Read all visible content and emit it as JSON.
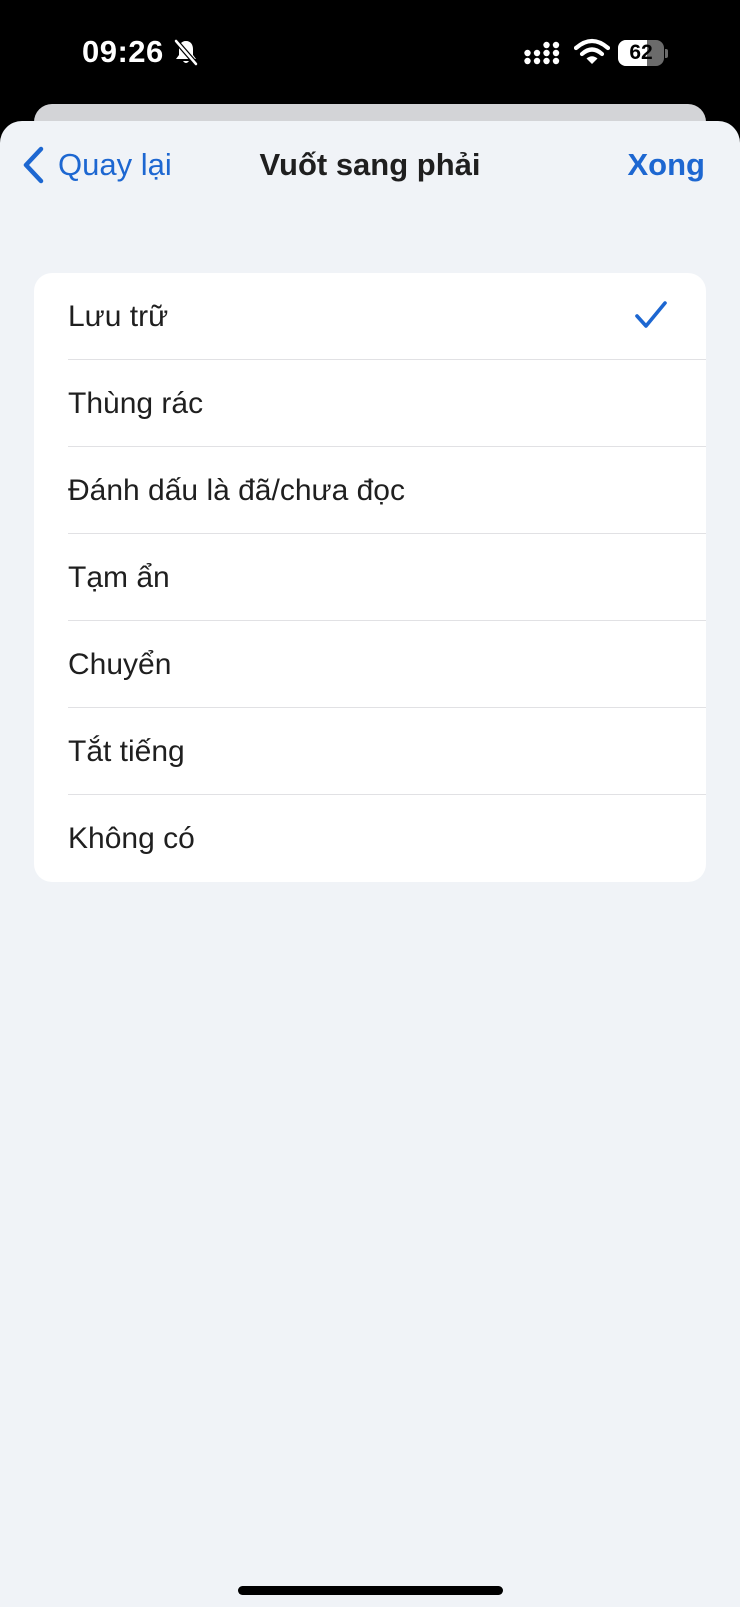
{
  "status_bar": {
    "time": "09:26",
    "battery_level": "62",
    "battery_fraction": 0.62
  },
  "nav": {
    "back_label": "Quay lại",
    "title": "Vuốt sang phải",
    "done_label": "Xong"
  },
  "options": [
    {
      "label": "Lưu trữ",
      "selected": true
    },
    {
      "label": "Thùng rác",
      "selected": false
    },
    {
      "label": "Đánh dấu là đã/chưa đọc",
      "selected": false
    },
    {
      "label": "Tạm ẩn",
      "selected": false
    },
    {
      "label": "Chuyển",
      "selected": false
    },
    {
      "label": "Tắt tiếng",
      "selected": false
    },
    {
      "label": "Không có",
      "selected": false
    }
  ],
  "colors": {
    "accent": "#1d67d1",
    "sheet_background": "#f0f3f7",
    "list_background": "#ffffff",
    "text": "#1f1f1f"
  },
  "icons": {
    "status": [
      "bell-slash-icon",
      "cellular-signal-icon",
      "wifi-icon",
      "battery-icon"
    ],
    "nav_back": "chevron-left-icon",
    "selection": "checkmark-icon"
  }
}
